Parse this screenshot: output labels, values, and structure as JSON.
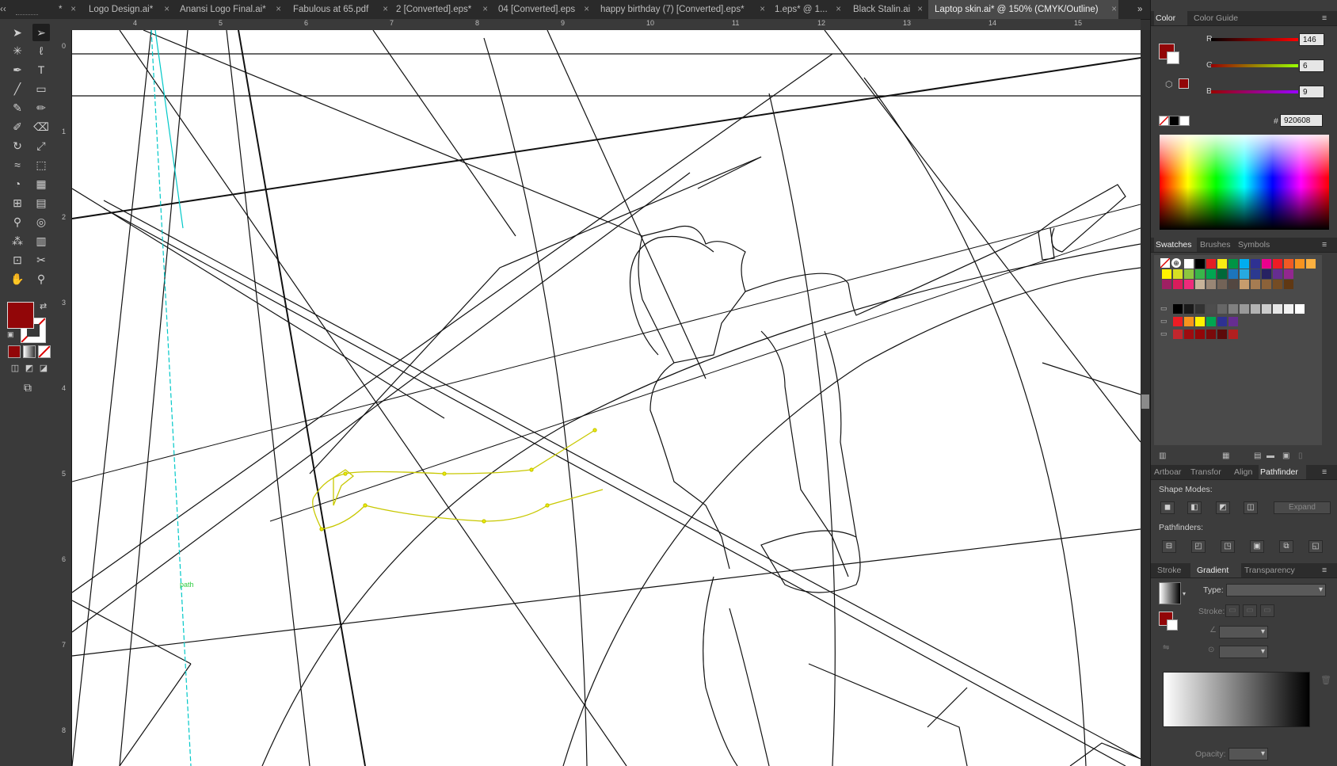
{
  "tabs": [
    {
      "label": "*",
      "close": "×"
    },
    {
      "label": "Logo Design.ai*",
      "close": "×"
    },
    {
      "label": "Anansi Logo Final.ai*",
      "close": "×"
    },
    {
      "label": "Fabulous at 65.pdf",
      "close": "×"
    },
    {
      "label": "2 [Converted].eps*",
      "close": "×"
    },
    {
      "label": "04 [Converted].eps",
      "close": "×"
    },
    {
      "label": "happy birthday (7) [Converted].eps*",
      "close": "×"
    },
    {
      "label": "1.eps* @ 1...",
      "close": "×"
    },
    {
      "label": "Black Stalin.ai",
      "close": "×"
    },
    {
      "label": "Laptop skin.ai* @ 150% (CMYK/Outline)",
      "close": "×"
    }
  ],
  "tab_overflow": "»",
  "ruler": {
    "top": [
      "4",
      "5",
      "6",
      "7",
      "8",
      "9",
      "10",
      "11",
      "12",
      "13",
      "14",
      "15"
    ],
    "left": [
      "0",
      "1",
      "2",
      "3",
      "4",
      "5",
      "6",
      "7",
      "8"
    ]
  },
  "canvas": {
    "path_label": "path"
  },
  "color_panel": {
    "tabs": [
      "Color",
      "Color Guide"
    ],
    "r_label": "R",
    "r_value": "146",
    "g_label": "G",
    "g_value": "6",
    "b_label": "B",
    "b_value": "9",
    "hex_label": "#",
    "hex_value": "920608",
    "fill_color": "#920608"
  },
  "swatches_panel": {
    "tabs": [
      "Swatches",
      "Brushes",
      "Symbols"
    ],
    "row1": [
      "#ffffff",
      "#000000",
      "#e31e24",
      "#f7ec13",
      "#009444",
      "#00adef",
      "#2e3192",
      "#ec008c",
      "#ed1c24",
      "#f15a24",
      "#f7931e",
      "#fbb040"
    ],
    "row2": [
      "#fff200",
      "#d7df23",
      "#8dc63f",
      "#39b54a",
      "#00a651",
      "#006838",
      "#1c75bc",
      "#27aae1",
      "#2b3990",
      "#262262",
      "#662d91",
      "#92278f"
    ],
    "row3": [
      "#9e1f63",
      "#da1c5c",
      "#ee2a7b",
      "#c7b299",
      "#998675",
      "#736357",
      "#534741",
      "#c69c6d",
      "#a67c52",
      "#8c6239",
      "#754c24",
      "#603813"
    ],
    "row5": [
      "#000000",
      "#1a1a1a",
      "#333333",
      "#4d4d4d",
      "#666666",
      "#808080",
      "#999999",
      "#b3b3b3",
      "#cccccc",
      "#e6e6e6",
      "#f2f2f2",
      "#ffffff"
    ],
    "row6": [
      "#ed1c24",
      "#f7941d",
      "#fff200",
      "#00a651",
      "#2e3192",
      "#662d91"
    ],
    "row7": [
      "#c1272d",
      "#9e0b0f",
      "#920608",
      "#7a0a0b",
      "#5c0a0a",
      "#b21f1f"
    ]
  },
  "pathfinder_panel": {
    "tabs": [
      "Artboar",
      "Transfor",
      "Align",
      "Pathfinder"
    ],
    "shape_modes_label": "Shape Modes:",
    "expand_label": "Expand",
    "pathfinders_label": "Pathfinders:"
  },
  "gradient_panel": {
    "tabs": [
      "Stroke",
      "Gradient",
      "Transparency"
    ],
    "type_label": "Type:",
    "stroke_label": "Stroke:",
    "opacity_label": "Opacity:"
  }
}
